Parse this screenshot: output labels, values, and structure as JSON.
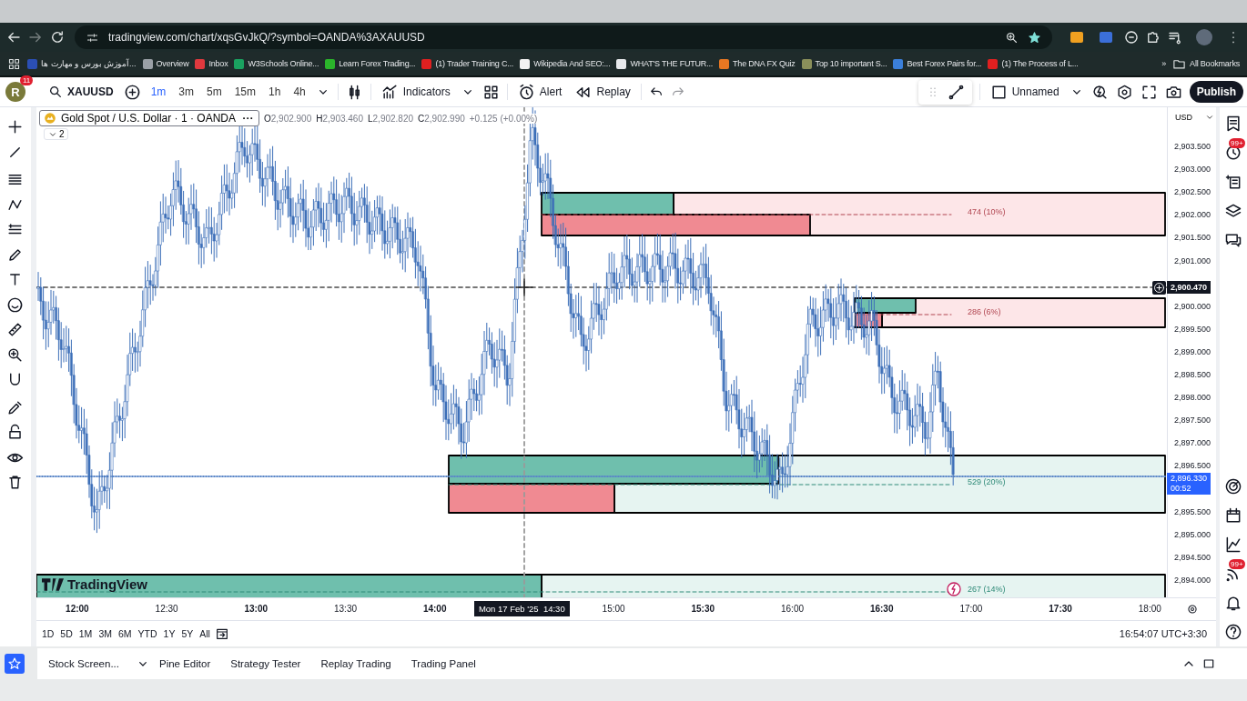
{
  "browser": {
    "url": "tradingview.com/chart/xqsGvJkQ/?symbol=OANDA%3AXAUUSD",
    "bookmarks": [
      {
        "label": "آموزش بورس و مهارت ها...",
        "color": "#2b4fb5"
      },
      {
        "label": "Overview",
        "color": "#9aa0a6"
      },
      {
        "label": "Inbox",
        "color": "#e0393e"
      },
      {
        "label": "W3Schools Online...",
        "color": "#1aa260"
      },
      {
        "label": "Learn Forex Trading...",
        "color": "#2bb52b"
      },
      {
        "label": "(1) Trader Training C...",
        "color": "#e02020"
      },
      {
        "label": "Wikipedia And SEO:...",
        "color": "#f2f2f2"
      },
      {
        "label": "WHAT'S THE FUTUR...",
        "color": "#e8eaed"
      },
      {
        "label": "The DNA FX Quiz",
        "color": "#e87722"
      },
      {
        "label": "Top 10 important S...",
        "color": "#8a8f5a"
      },
      {
        "label": "Best Forex Pairs for...",
        "color": "#3b7fd9"
      },
      {
        "label": "(1) The Process of L...",
        "color": "#e02020"
      }
    ],
    "overflow": "»",
    "all_bookmarks": "All Bookmarks"
  },
  "toolbar": {
    "avatar": "R",
    "avatar_badge": "11",
    "symbol": "XAUUSD",
    "intervals": [
      {
        "label": "1m",
        "selected": true
      },
      {
        "label": "3m",
        "selected": false
      },
      {
        "label": "5m",
        "selected": false
      },
      {
        "label": "15m",
        "selected": false
      },
      {
        "label": "1h",
        "selected": false
      },
      {
        "label": "4h",
        "selected": false
      }
    ],
    "indicators": "Indicators",
    "alert": "Alert",
    "replay": "Replay",
    "layout_name": "Unnamed",
    "publish": "Publish"
  },
  "legend": {
    "title": "Gold Spot / U.S. Dollar · 1 · OANDA",
    "ohlc": [
      {
        "key": "O",
        "value": "2,902.900"
      },
      {
        "key": "H",
        "value": "2,903.460"
      },
      {
        "key": "L",
        "value": "2,902.820"
      },
      {
        "key": "C",
        "value": "2,902.990"
      }
    ],
    "change": "+0.125 (+0.00%)",
    "collapsed_count": "2"
  },
  "chart": {
    "logo": "TradingView",
    "positions": [
      {
        "kind": "short",
        "label": "474 (10%)"
      },
      {
        "kind": "short",
        "label": "286 (6%)"
      },
      {
        "kind": "long",
        "label": "529 (20%)"
      },
      {
        "kind": "long",
        "label": "267 (14%)"
      }
    ]
  },
  "price_axis": {
    "currency": "USD",
    "labels": [
      "2,903.500",
      "2,903.000",
      "2,902.500",
      "2,902.000",
      "2,901.500",
      "2,901.000",
      "2,900.000",
      "2,899.500",
      "2,899.000",
      "2,898.500",
      "2,898.000",
      "2,897.500",
      "2,897.000",
      "2,896.500",
      "2,895.500",
      "2,895.000",
      "2,894.500",
      "2,894.000"
    ],
    "crosshair_price": "2,900.470",
    "last_price": "2,896.330",
    "countdown": "00:52"
  },
  "time_axis": {
    "labels": [
      "12:00",
      "12:30",
      "13:00",
      "13:30",
      "14:00",
      "15:00",
      "15:30",
      "16:00",
      "16:30",
      "17:00",
      "17:30",
      "18:00"
    ],
    "crosshair_time": "Mon 17 Feb '25  14:30"
  },
  "ranges": [
    "1D",
    "5D",
    "1M",
    "3M",
    "6M",
    "YTD",
    "1Y",
    "5Y",
    "All"
  ],
  "clock": "16:54:07 UTC+3:30",
  "bottom_tabs": [
    "Stock Screen...",
    "Pine Editor",
    "Strategy Tester",
    "Replay Trading",
    "Trading Panel"
  ],
  "sidebar_badges": [
    "99+",
    "99+"
  ]
}
